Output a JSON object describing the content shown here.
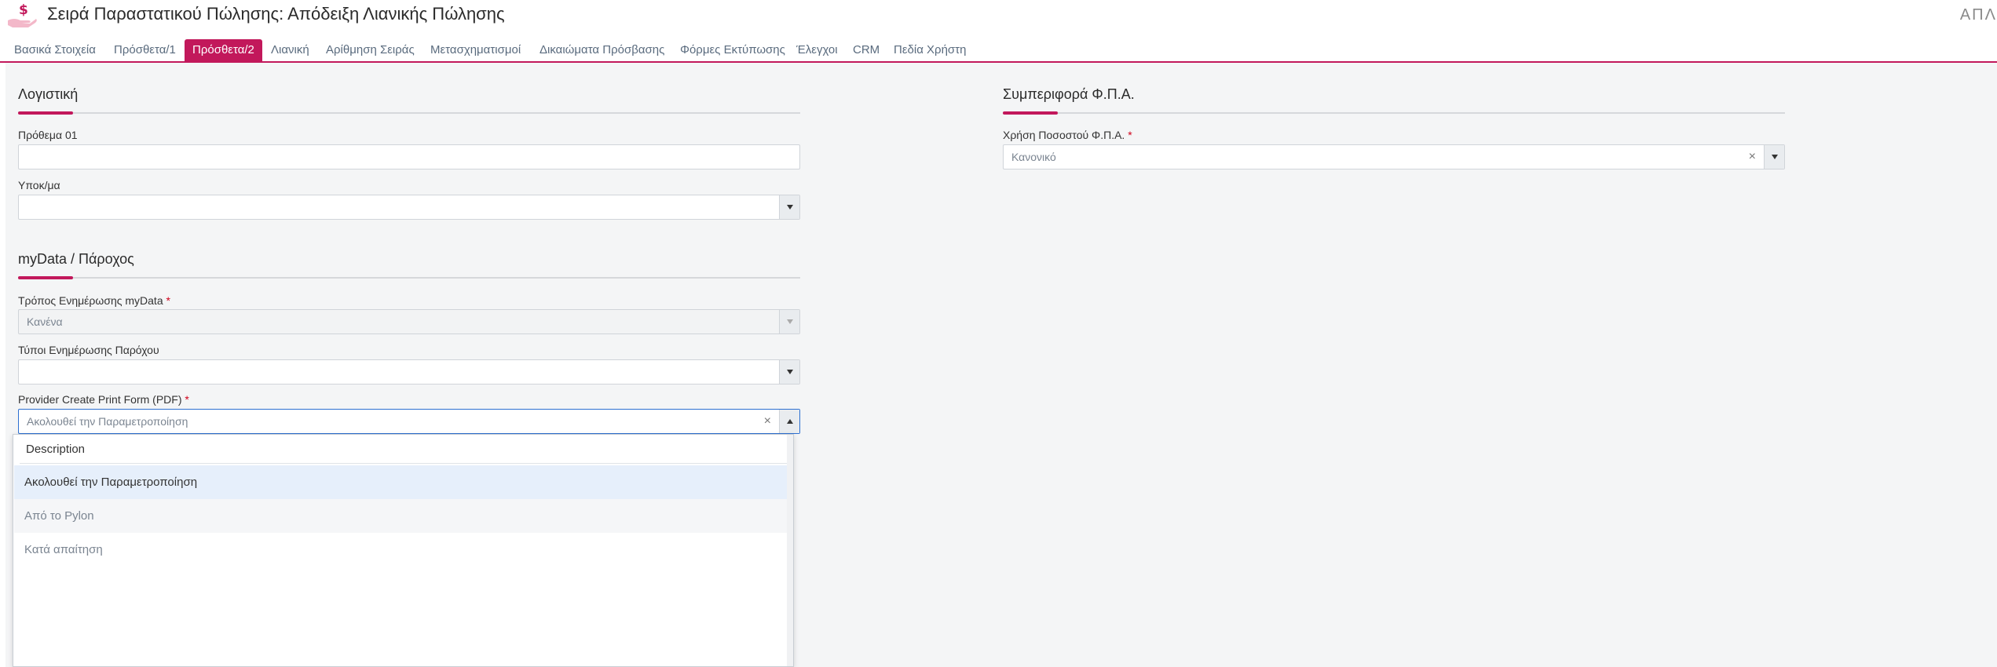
{
  "header": {
    "title": "Σειρά Παραστατικού Πώλησης: Απόδειξη Λιανικής Πώλησης",
    "right_text": "ΑΠΛ",
    "logo_icon": "hand-dollar-icon",
    "accent_color": "#c2185b"
  },
  "tabs": [
    {
      "label": "Βασικά Στοιχεία",
      "active": false
    },
    {
      "label": "Πρόσθετα/1",
      "active": false
    },
    {
      "label": "Πρόσθετα/2",
      "active": true
    },
    {
      "label": "Λιανική",
      "active": false
    },
    {
      "label": "Αρίθμηση Σειράς",
      "active": false
    },
    {
      "label": "Μετασχηματισμοί",
      "active": false
    },
    {
      "label": "Δικαιώματα Πρόσβασης",
      "active": false
    },
    {
      "label": "Φόρμες Εκτύπωσης",
      "active": false
    },
    {
      "label": "Έλεγχοι",
      "active": false
    },
    {
      "label": "CRM",
      "active": false
    },
    {
      "label": "Πεδία Χρήστη",
      "active": false
    }
  ],
  "accounting": {
    "title": "Λογιστική",
    "prefix_label": "Πρόθεμα 01",
    "prefix_value": "",
    "subaccount_label": "Υποκ/μα",
    "subaccount_value": ""
  },
  "mydata": {
    "title": "myData / Πάροχος",
    "update_mode_label": "Τρόπος Ενημέρωσης myData",
    "update_mode_value": "Κανένα",
    "provider_types_label": "Τύποι Ενημέρωσης Παρόχου",
    "provider_types_value": "",
    "print_form_label": "Provider Create Print Form (PDF)",
    "print_form_value": "Ακολουθεί την Παραμετροποίηση",
    "required_mark": "*"
  },
  "dropdown": {
    "header": "Description",
    "options": [
      "Ακολουθεί την Παραμετροποίηση",
      "Από το Pylon",
      "Κατά απαίτηση"
    ]
  },
  "vat": {
    "title": "Συμπεριφορά Φ.Π.Α.",
    "rate_usage_label": "Χρήση Ποσοστού Φ.Π.Α.",
    "rate_usage_value": "Κανονικό"
  },
  "icons": {
    "clear": "×"
  }
}
